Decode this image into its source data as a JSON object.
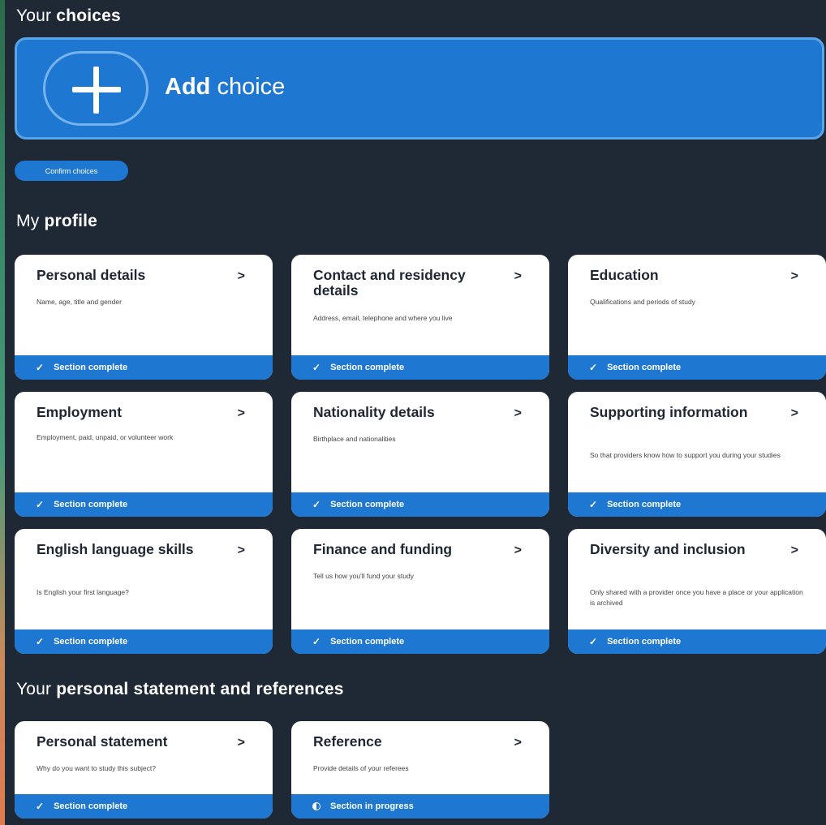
{
  "choices": {
    "heading_prefix": "Your",
    "heading_bold": "choices",
    "add_bold": "Add",
    "add_rest": "choice",
    "confirm_label": "Confirm choices"
  },
  "profile": {
    "heading_prefix": "My",
    "heading_bold": "profile",
    "cards": [
      {
        "title": "Personal details",
        "desc": "Name, age, title and gender",
        "status": "Section complete"
      },
      {
        "title": "Contact and residency details",
        "desc": "Address, email, telephone and where you live",
        "status": "Section complete"
      },
      {
        "title": "Education",
        "desc": "Qualifications and periods of study",
        "status": "Section complete"
      },
      {
        "title": "Employment",
        "desc": "Employment, paid, unpaid, or volunteer work",
        "status": "Section complete"
      },
      {
        "title": "Nationality details",
        "desc": "Birthplace and nationalities",
        "status": "Section complete"
      },
      {
        "title": "Supporting information",
        "desc": "So that providers know how to support you during your studies",
        "status": "Section complete"
      },
      {
        "title": "English language skills",
        "desc": "Is English your first language?",
        "status": "Section complete"
      },
      {
        "title": "Finance and funding",
        "desc": "Tell us how you'll fund your study",
        "status": "Section complete"
      },
      {
        "title": "Diversity and inclusion",
        "desc": "Only shared with a provider once you have a place or your application is archived",
        "status": "Section complete"
      }
    ]
  },
  "statement": {
    "heading_prefix": "Your",
    "heading_bold": "personal statement and references",
    "cards": [
      {
        "title": "Personal statement",
        "desc": "Why do you want to study this subject?",
        "status": "Section complete"
      },
      {
        "title": "Reference",
        "desc": "Provide details of your referees",
        "status": "Section in progress"
      }
    ]
  },
  "icons": {
    "chevron": ">",
    "check": "✓",
    "add": "plus-icon",
    "in_progress": "half-circle-icon"
  },
  "colors": {
    "background": "#1f2835",
    "accent": "#1e78d2",
    "card": "#ffffff"
  }
}
